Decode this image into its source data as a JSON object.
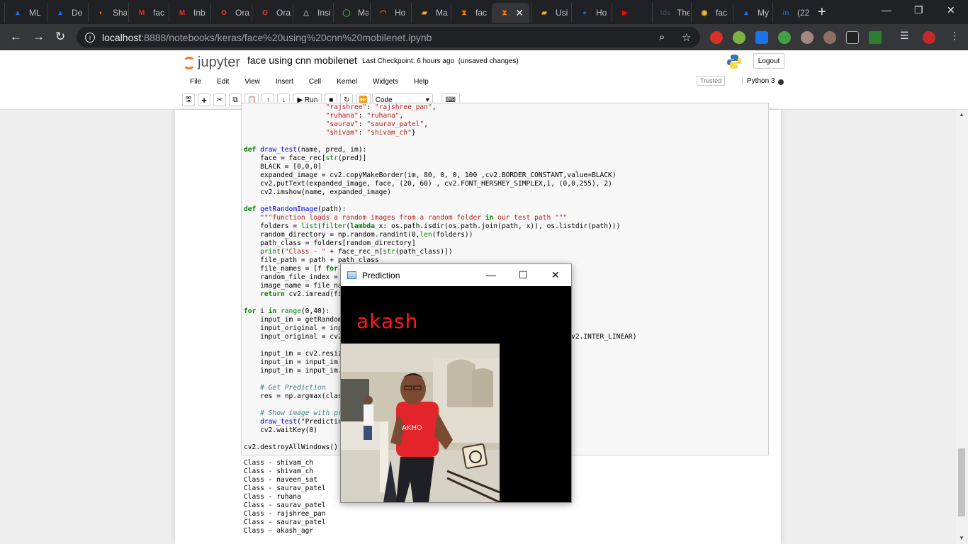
{
  "browser": {
    "tabs": [
      {
        "label": "ML",
        "color": "#1a73e8",
        "glyph": "▲"
      },
      {
        "label": "De",
        "color": "#1a73e8",
        "glyph": "▲"
      },
      {
        "label": "Sha",
        "color": "#f57c00",
        "glyph": "◐"
      },
      {
        "label": "fac",
        "color": "#d93025",
        "glyph": "M"
      },
      {
        "label": "Inb",
        "color": "#d93025",
        "glyph": "M"
      },
      {
        "label": "Ora",
        "color": "#e53935",
        "glyph": "O"
      },
      {
        "label": "Ora",
        "color": "#e53935",
        "glyph": "O"
      },
      {
        "label": "Insi",
        "color": "#9aa0a6",
        "glyph": "△"
      },
      {
        "label": "Ma",
        "color": "#43a047",
        "glyph": "◯"
      },
      {
        "label": "Ho",
        "color": "#ef6c00",
        "glyph": "◠"
      },
      {
        "label": "Ma",
        "color": "#f9a825",
        "glyph": "▰"
      },
      {
        "label": "fac",
        "color": "#f57c00",
        "glyph": "⧗"
      },
      {
        "label": "",
        "color": "#f57c00",
        "glyph": "⧗"
      },
      {
        "label": "Usi",
        "color": "#f9a825",
        "glyph": "▰"
      },
      {
        "label": "Ho",
        "color": "#1565c0",
        "glyph": "●"
      },
      {
        "label": "",
        "color": "#ff0000",
        "glyph": "▶"
      },
      {
        "label": "The",
        "color": "#37474f",
        "glyph": "tds"
      },
      {
        "label": "fac",
        "color": "#fbc02d",
        "glyph": "◉"
      },
      {
        "label": "My",
        "color": "#1a73e8",
        "glyph": "▲"
      },
      {
        "label": "(22",
        "color": "#0a66c2",
        "glyph": "in"
      }
    ],
    "active_tab_index": 12,
    "url_host": "localhost",
    "url_path": ":8888/notebooks/keras/face%20using%20cnn%20mobilenet.ipynb"
  },
  "jupyter": {
    "logo_text": "jupyter",
    "notebook_title": "face using cnn mobilenet",
    "checkpoint": "Last Checkpoint: 6 hours ago",
    "unsaved": "(unsaved changes)",
    "logout_label": "Logout",
    "menu": [
      "File",
      "Edit",
      "View",
      "Insert",
      "Cell",
      "Kernel",
      "Widgets",
      "Help"
    ],
    "trusted_label": "Trusted",
    "kernel_label": "Python 3",
    "run_label": "Run",
    "cell_type": "Code"
  },
  "code_lines": [
    "                    \"rajshree\": \"rajshree_pan\",",
    "                    \"ruhana\": \"ruhana\",",
    "                    \"saurav\": \"saurav_patel\",",
    "                    \"shivam\": \"shivam_ch\"}",
    "",
    "def draw_test(name, pred, im):",
    "    face = face_rec[str(pred)]",
    "    BLACK = [0,0,0]",
    "    expanded_image = cv2.copyMakeBorder(im, 80, 0, 0, 100 ,cv2.BORDER_CONSTANT,value=BLACK)",
    "    cv2.putText(expanded_image, face, (20, 60) , cv2.FONT_HERSHEY_SIMPLEX,1, (0,0,255), 2)",
    "    cv2.imshow(name, expanded_image)",
    "",
    "def getRandomImage(path):",
    "    \"\"\"function loads a random images from a random folder in our test path \"\"\"",
    "    folders = list(filter(lambda x: os.path.isdir(os.path.join(path, x)), os.listdir(path)))",
    "    random_directory = np.random.randint(0,len(folders))",
    "    path_class = folders[random_directory]",
    "    print(\"Class - \" + face_rec_n[str(path_class)])",
    "    file_path = path + path_class",
    "    file_names = [f for",
    "    random_file_index =",
    "    image_name = file_na",
    "    return cv2.imread(fi",
    "",
    "for i in range(0,40):",
    "    input_im = getRandom",
    "    input_original = inp",
    "    input_original = cv2                                       interpolation = cv2.INTER_LINEAR)",
    "",
    "    input_im = cv2.resiz                                       )",
    "    input_im = input_im",
    "    input_im = input_im.",
    "",
    "    # Get Prediction",
    "    res = np.argmax(clas",
    "",
    "    # Show image with pr",
    "    draw_test(\"Predictic",
    "    cv2.waitKey(0)",
    "",
    "cv2.destroyAllWindows()"
  ],
  "output_lines": [
    "Class - shivam_ch",
    "Class - shivam_ch",
    "Class - naveen_sat",
    "Class - saurav_patel",
    "Class - ruhana",
    "Class - saurav_patel",
    "Class - rajshree_pan",
    "Class - saurav_patel",
    "Class - akash_agr"
  ],
  "cv_window": {
    "title": "Prediction",
    "prediction_text": "akash",
    "prediction_color": "#ff1a1a"
  }
}
